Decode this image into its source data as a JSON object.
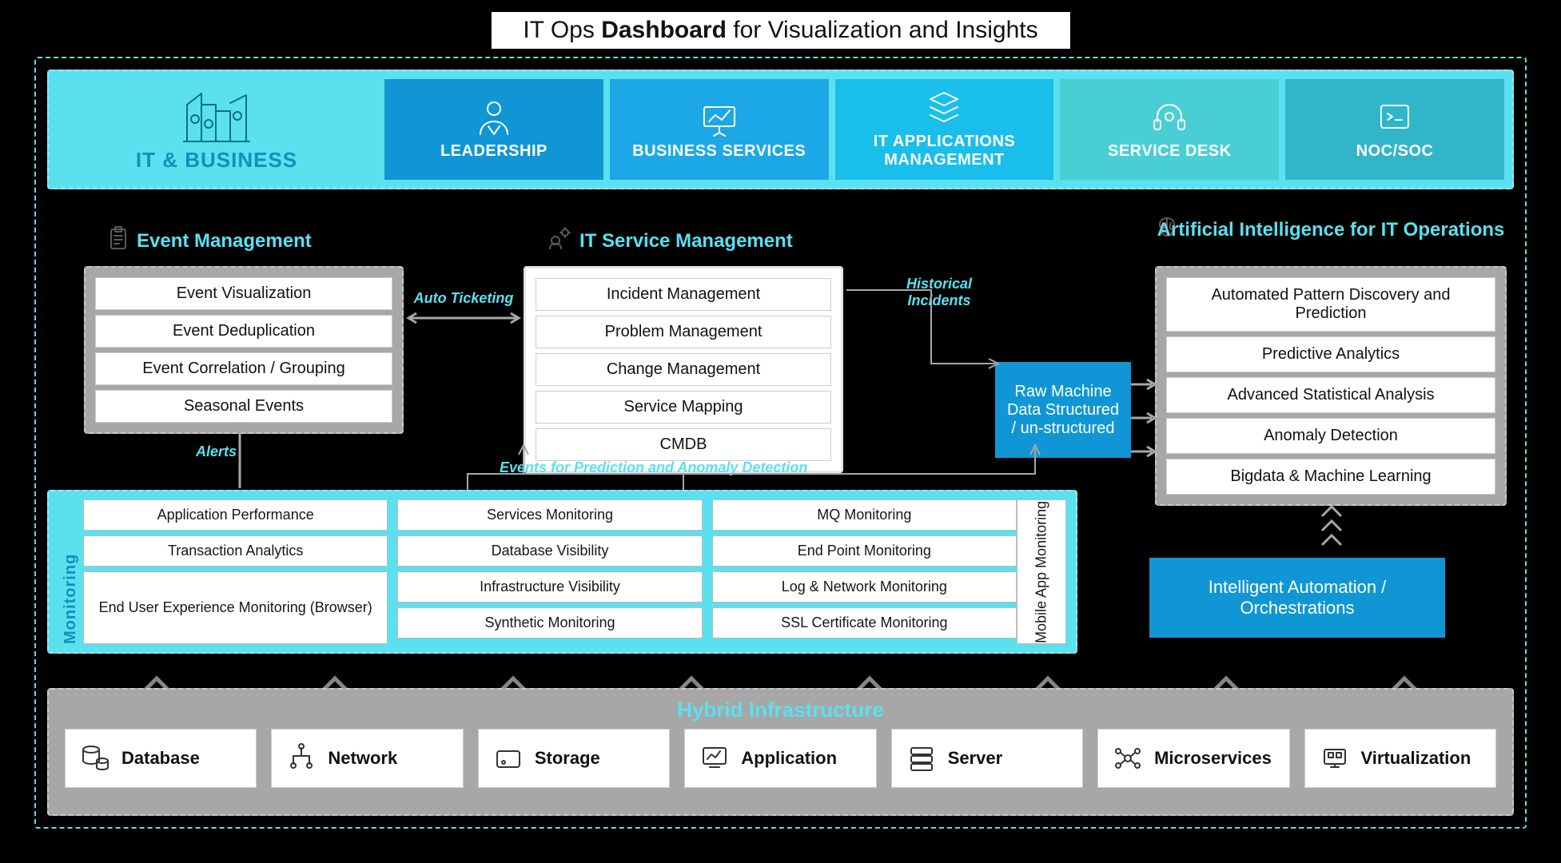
{
  "title_plain1": "IT Ops ",
  "title_bold": "Dashboard",
  "title_plain2": " for Visualization and Insights",
  "lead_card": {
    "label": "IT & BUSINESS"
  },
  "tabs": [
    {
      "label": "LEADERSHIP"
    },
    {
      "label": "BUSINESS SERVICES"
    },
    {
      "label": "IT APPLICATIONS MANAGEMENT"
    },
    {
      "label": "SERVICE DESK"
    },
    {
      "label": "NOC/SOC"
    }
  ],
  "sections": {
    "event_mgmt": {
      "title": "Event Management",
      "items": [
        "Event Visualization",
        "Event Deduplication",
        "Event Correlation / Grouping",
        "Seasonal Events"
      ]
    },
    "itsm": {
      "title": "IT Service Management",
      "items": [
        "Incident Management",
        "Problem Management",
        "Change Management",
        "Service Mapping",
        "CMDB"
      ]
    },
    "aiops": {
      "title": "Artificial Intelligence for IT Operations",
      "items": [
        "Automated Pattern Discovery and Prediction",
        "Predictive Analytics",
        "Advanced Statistical Analysis",
        "Anomaly Detection",
        "Bigdata & Machine Learning"
      ]
    }
  },
  "connectors": {
    "auto_ticketing": "Auto Ticketing",
    "alerts": "Alerts",
    "historical": "Historical Incidents",
    "events_predict": "Events for Prediction and Anomaly Detection"
  },
  "raw_box": "Raw Machine Data Structured / un-structured",
  "monitoring": {
    "label": "Monitoring",
    "col1": [
      "Application Performance",
      "Transaction Analytics",
      "End User Experience Monitoring (Browser)"
    ],
    "col2": [
      "Services Monitoring",
      "Database Visibility",
      "Infrastructure Visibility",
      "Synthetic Monitoring"
    ],
    "col3": [
      "MQ Monitoring",
      "End Point Monitoring",
      "Log & Network Monitoring",
      "SSL Certificate Monitoring"
    ],
    "mobile": "Mobile App Monitoring"
  },
  "automation_box": "Intelligent Automation / Orchestrations",
  "hybrid": {
    "title": "Hybrid Infrastructure",
    "items": [
      "Database",
      "Network",
      "Storage",
      "Application",
      "Server",
      "Microservices",
      "Virtualization"
    ]
  }
}
